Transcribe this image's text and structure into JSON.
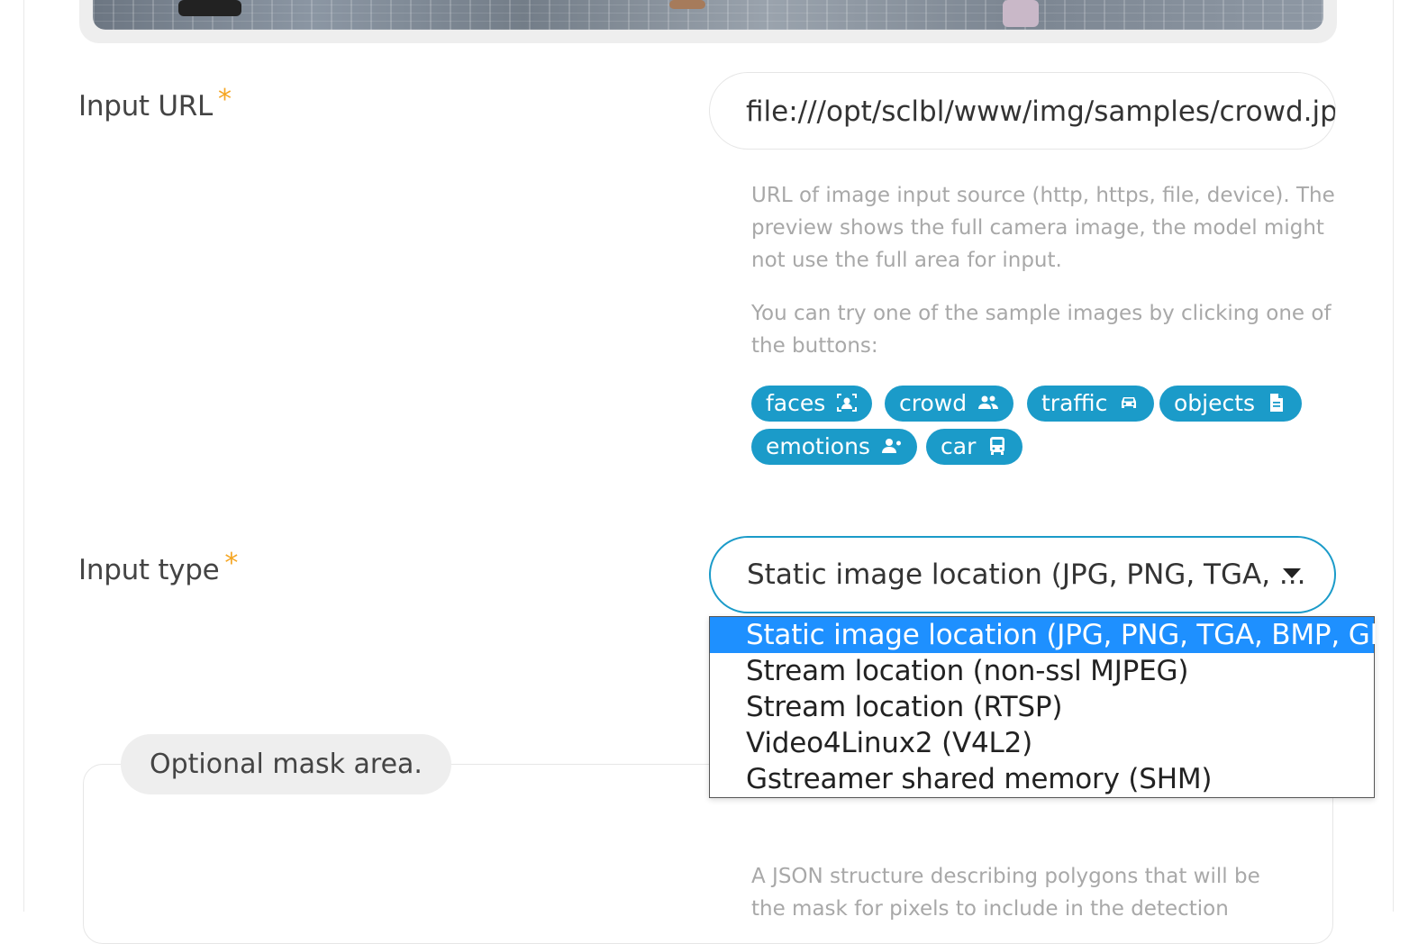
{
  "input_url": {
    "label": "Input URL",
    "required_mark": "*",
    "value": "file:///opt/sclbl/www/img/samples/crowd.jpg",
    "help_1": "URL of image input source (http, https, file, device). The preview shows the full camera image, the model might not use the full area for input.",
    "help_2": "You can try one of the sample images by clicking one of the buttons:"
  },
  "sample_buttons": [
    {
      "label": "faces",
      "icon": "portrait-icon"
    },
    {
      "label": "crowd",
      "icon": "users-icon"
    },
    {
      "label": "traffic",
      "icon": "car-icon"
    },
    {
      "label": "objects",
      "icon": "file-icon"
    },
    {
      "label": "emotions",
      "icon": "user-tag-icon"
    },
    {
      "label": "car",
      "icon": "bus-icon"
    }
  ],
  "input_type": {
    "label": "Input type",
    "required_mark": "*",
    "selected": "Static image location (JPG, PNG, TGA, ...",
    "options": [
      "Static image location (JPG, PNG, TGA, BMP, GIF)",
      "Stream location (non-ssl MJPEG)",
      "Stream location (RTSP)",
      "Video4Linux2 (V4L2)",
      "Gstreamer shared memory (SHM)"
    ]
  },
  "mask_area": {
    "legend": "Optional mask area.",
    "help": "A JSON structure describing polygons that will be the mask for pixels to include in the detection"
  },
  "colors": {
    "accent": "#1b9bc9",
    "required": "#f5a623",
    "option_highlight": "#1e90ff"
  }
}
